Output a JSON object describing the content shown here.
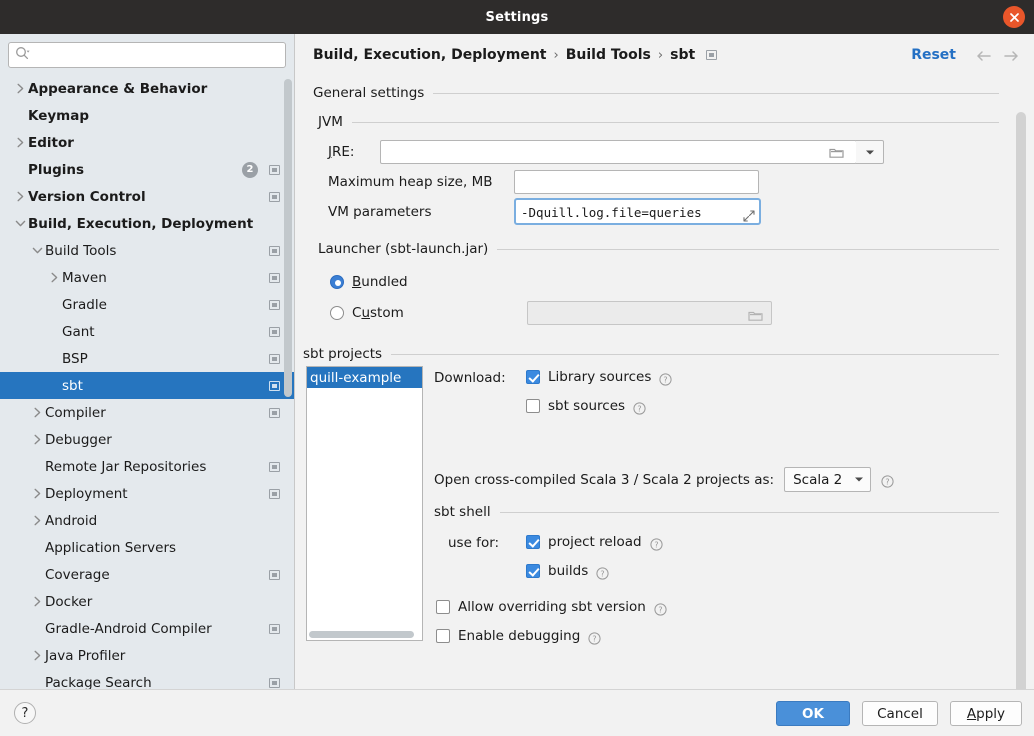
{
  "window": {
    "title": "Settings",
    "close_icon": "close-icon"
  },
  "sidebar": {
    "search": {
      "placeholder": "",
      "value": "",
      "icon": "search-icon"
    },
    "items": [
      {
        "label": "Appearance & Behavior",
        "indent": 0,
        "arrow": "right",
        "bold": true,
        "stub": false,
        "badge": null,
        "selected": false
      },
      {
        "label": "Keymap",
        "indent": 0,
        "arrow": "none",
        "bold": true,
        "stub": false,
        "badge": null,
        "selected": false
      },
      {
        "label": "Editor",
        "indent": 0,
        "arrow": "right",
        "bold": true,
        "stub": false,
        "badge": null,
        "selected": false
      },
      {
        "label": "Plugins",
        "indent": 0,
        "arrow": "none",
        "bold": true,
        "stub": true,
        "badge": "2",
        "selected": false
      },
      {
        "label": "Version Control",
        "indent": 0,
        "arrow": "right",
        "bold": true,
        "stub": true,
        "badge": null,
        "selected": false
      },
      {
        "label": "Build, Execution, Deployment",
        "indent": 0,
        "arrow": "down",
        "bold": true,
        "stub": false,
        "badge": null,
        "selected": false
      },
      {
        "label": "Build Tools",
        "indent": 1,
        "arrow": "down",
        "bold": false,
        "stub": true,
        "badge": null,
        "selected": false
      },
      {
        "label": "Maven",
        "indent": 2,
        "arrow": "right",
        "bold": false,
        "stub": true,
        "badge": null,
        "selected": false
      },
      {
        "label": "Gradle",
        "indent": 2,
        "arrow": "none",
        "bold": false,
        "stub": true,
        "badge": null,
        "selected": false
      },
      {
        "label": "Gant",
        "indent": 2,
        "arrow": "none",
        "bold": false,
        "stub": true,
        "badge": null,
        "selected": false
      },
      {
        "label": "BSP",
        "indent": 2,
        "arrow": "none",
        "bold": false,
        "stub": true,
        "badge": null,
        "selected": false
      },
      {
        "label": "sbt",
        "indent": 2,
        "arrow": "none",
        "bold": false,
        "stub": true,
        "badge": null,
        "selected": true
      },
      {
        "label": "Compiler",
        "indent": 1,
        "arrow": "right",
        "bold": false,
        "stub": true,
        "badge": null,
        "selected": false
      },
      {
        "label": "Debugger",
        "indent": 1,
        "arrow": "right",
        "bold": false,
        "stub": false,
        "badge": null,
        "selected": false
      },
      {
        "label": "Remote Jar Repositories",
        "indent": 1,
        "arrow": "none",
        "bold": false,
        "stub": true,
        "badge": null,
        "selected": false
      },
      {
        "label": "Deployment",
        "indent": 1,
        "arrow": "right",
        "bold": false,
        "stub": true,
        "badge": null,
        "selected": false
      },
      {
        "label": "Android",
        "indent": 1,
        "arrow": "right",
        "bold": false,
        "stub": false,
        "badge": null,
        "selected": false
      },
      {
        "label": "Application Servers",
        "indent": 1,
        "arrow": "none",
        "bold": false,
        "stub": false,
        "badge": null,
        "selected": false
      },
      {
        "label": "Coverage",
        "indent": 1,
        "arrow": "none",
        "bold": false,
        "stub": true,
        "badge": null,
        "selected": false
      },
      {
        "label": "Docker",
        "indent": 1,
        "arrow": "right",
        "bold": false,
        "stub": false,
        "badge": null,
        "selected": false
      },
      {
        "label": "Gradle-Android Compiler",
        "indent": 1,
        "arrow": "none",
        "bold": false,
        "stub": true,
        "badge": null,
        "selected": false
      },
      {
        "label": "Java Profiler",
        "indent": 1,
        "arrow": "right",
        "bold": false,
        "stub": false,
        "badge": null,
        "selected": false
      },
      {
        "label": "Package Search",
        "indent": 1,
        "arrow": "none",
        "bold": false,
        "stub": true,
        "badge": null,
        "selected": false
      }
    ]
  },
  "header": {
    "breadcrumb": [
      "Build, Execution, Deployment",
      "Build Tools",
      "sbt"
    ],
    "separator": "›",
    "reset_label": "Reset",
    "back_icon": "arrow-left-icon",
    "forward_icon": "arrow-right-icon"
  },
  "main": {
    "general_settings_title": "General settings",
    "jvm": {
      "title": "JVM",
      "jre_label": "JRE:",
      "jre_value": "",
      "browse_icon": "folder-icon",
      "dropdown_icon": "chevron-down-icon",
      "max_heap_label": "Maximum heap size, MB",
      "max_heap_value": "",
      "vm_params_label": "VM parameters",
      "vm_params_value": "-Dquill.log.file=queries",
      "expand_icon": "expand-icon"
    },
    "launcher": {
      "title": "Launcher (sbt-launch.jar)",
      "bundled_label": "Bundled",
      "bundled_selected": true,
      "custom_label": "Custom",
      "custom_selected": false,
      "custom_path_value": "",
      "browse_icon": "folder-icon"
    },
    "sbt_projects": {
      "title": "sbt projects",
      "projects": [
        "quill-example"
      ],
      "selected_project": "quill-example",
      "download_label": "Download:",
      "library_sources_label": "Library sources",
      "library_sources_checked": true,
      "sbt_sources_label": "sbt sources",
      "sbt_sources_checked": false,
      "cross_compiled_label": "Open cross-compiled Scala 3 / Scala 2 projects as:",
      "cross_compiled_value": "Scala 2",
      "help_icon": "help-icon"
    },
    "sbt_shell": {
      "title": "sbt shell",
      "use_for_label": "use for:",
      "project_reload_label": "project reload",
      "project_reload_checked": true,
      "builds_label": "builds",
      "builds_checked": true,
      "allow_override_label": "Allow overriding sbt version",
      "allow_override_checked": false,
      "enable_debugging_label": "Enable debugging",
      "enable_debugging_checked": false
    }
  },
  "footer": {
    "help_label": "?",
    "ok_label": "OK",
    "cancel_label": "Cancel",
    "apply_label": "Apply"
  },
  "colors": {
    "accent_blue": "#2675bf",
    "primary_button": "#4a90d9",
    "link_blue": "#2470c4",
    "close_red": "#e9562a",
    "titlebar": "#2e2c2b",
    "sidebar_bg": "#e4e9ed",
    "content_bg": "#f2f2f2"
  }
}
